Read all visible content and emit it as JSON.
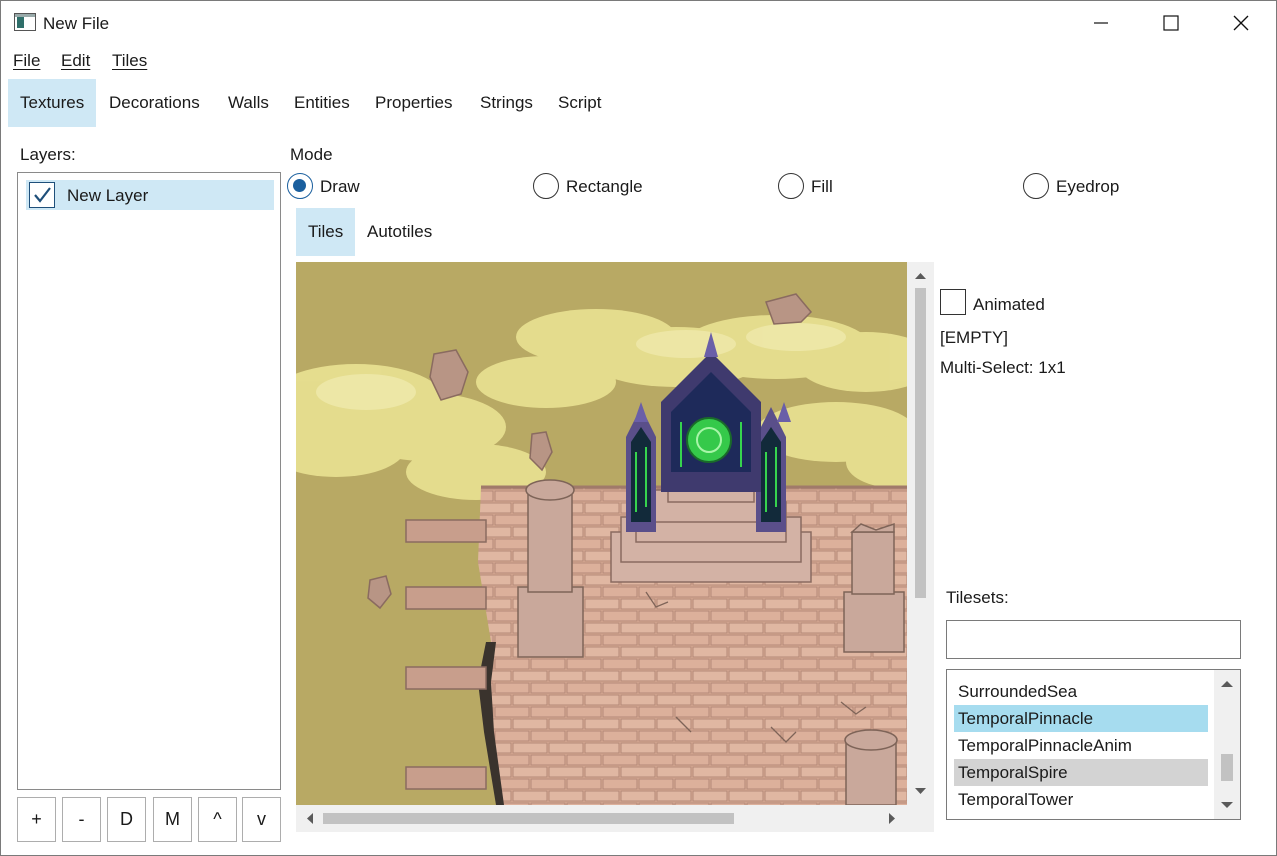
{
  "window": {
    "title": "New File",
    "controls": [
      "minimize-icon",
      "maximize-icon",
      "close-icon"
    ]
  },
  "menu": {
    "file": "File",
    "edit": "Edit",
    "tiles": "Tiles"
  },
  "top_tabs": {
    "textures": "Textures",
    "decorations": "Decorations",
    "walls": "Walls",
    "entities": "Entities",
    "properties": "Properties",
    "strings": "Strings",
    "script": "Script",
    "active": "Textures"
  },
  "layers": {
    "label": "Layers:",
    "items": [
      {
        "name": "New Layer",
        "checked": true
      }
    ],
    "buttons": {
      "add": "+",
      "remove": "-",
      "duplicate": "D",
      "merge": "M",
      "up": "^",
      "down": "v"
    }
  },
  "mode": {
    "label": "Mode",
    "options": {
      "draw": "Draw",
      "rectangle": "Rectangle",
      "fill": "Fill",
      "eyedrop": "Eyedrop"
    },
    "selected": "Draw"
  },
  "sub_tabs": {
    "tiles": "Tiles",
    "autotiles": "Autotiles",
    "active": "Tiles"
  },
  "tile_info": {
    "animated_label": "Animated",
    "animated_checked": false,
    "selection": "[EMPTY]",
    "multi_select": "Multi-Select: 1x1"
  },
  "tilesets": {
    "label": "Tilesets:",
    "search_value": "",
    "items": [
      "SurroundedSea",
      "TemporalPinnacle",
      "TemporalPinnacleAnim",
      "TemporalSpire",
      "TemporalTower"
    ],
    "selected": "TemporalPinnacle",
    "hovered": "TemporalSpire"
  },
  "colors": {
    "tab_active": "#cfe8f5",
    "list_selected": "#a6dcef",
    "radio_accent": "#1a5f9e",
    "sky": "#b8a964",
    "cloud": "#e6df8f",
    "brick": "#d7aa93",
    "crystal": "#35c94a"
  }
}
